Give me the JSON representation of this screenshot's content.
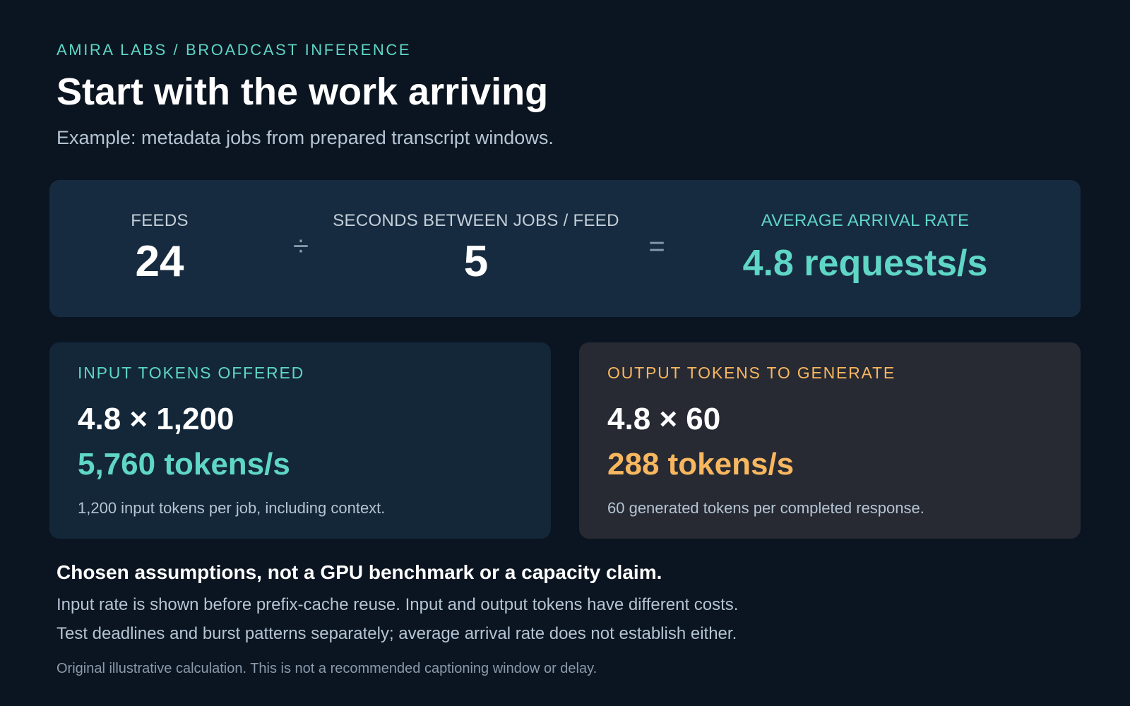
{
  "header": {
    "eyebrow": "AMIRA LABS / BROADCAST INFERENCE",
    "title": "Start with the work arriving",
    "subtitle": "Example: metadata jobs from prepared transcript windows."
  },
  "formula": {
    "feeds_label": "FEEDS",
    "feeds_value": "24",
    "divide_symbol": "÷",
    "interval_label": "SECONDS BETWEEN JOBS / FEED",
    "interval_value": "5",
    "equals_symbol": "=",
    "result_label": "AVERAGE ARRIVAL RATE",
    "result_value": "4.8 requests/s"
  },
  "input_card": {
    "title": "INPUT TOKENS OFFERED",
    "expression": "4.8 × 1,200",
    "rate": "5,760 tokens/s",
    "note": "1,200 input tokens per job, including context."
  },
  "output_card": {
    "title": "OUTPUT TOKENS TO GENERATE",
    "expression": "4.8 × 60",
    "rate": "288 tokens/s",
    "note": "60 generated tokens per completed response."
  },
  "footer": {
    "disclaimer": "Chosen assumptions, not a GPU benchmark or a capacity claim.",
    "line1": "Input rate is shown before prefix-cache reuse. Input and output tokens have different costs.",
    "line2": "Test deadlines and burst patterns separately; average arrival rate does not establish either.",
    "fine_print": "Original illustrative calculation. This is not a recommended captioning window or delay."
  },
  "colors": {
    "background": "#0b1521",
    "accent_teal": "#5fd6c6",
    "accent_orange": "#f8b75f",
    "formula_panel": "#172b40",
    "input_panel": "#132739",
    "output_panel": "#272a33"
  }
}
